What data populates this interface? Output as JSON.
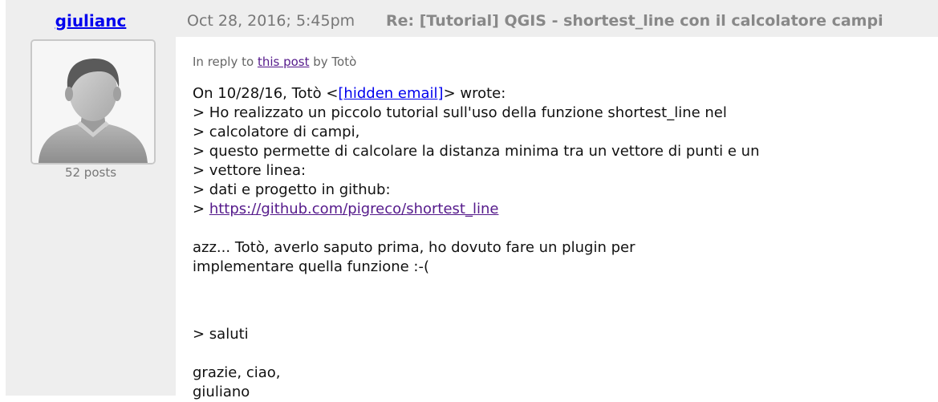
{
  "author": {
    "name": "giulianc",
    "posts": "52 posts"
  },
  "header": {
    "date": "Oct 28, 2016; 5:45pm",
    "subject": "Re: [Tutorial] QGIS - shortest_line con il calcolatore campi"
  },
  "reply": {
    "prefix": "In reply to ",
    "link": "this post",
    "suffix": " by Totò"
  },
  "message": {
    "intro_prefix": "On 10/28/16, Totò <",
    "intro_link": "[hidden email]",
    "intro_suffix": "> wrote:",
    "quote_lines": [
      "> Ho realizzato un piccolo tutorial sull'uso della funzione shortest_line nel",
      "> calcolatore di campi,",
      "> questo permette di calcolare la distanza minima tra un vettore di punti e un",
      "> vettore linea:",
      "> dati e progetto in github:"
    ],
    "url_prefix": "> ",
    "url": "https://github.com/pigreco/shortest_line",
    "reply_lines": [
      "azz... Totò, averlo saputo prima, ho dovuto fare un plugin per",
      "implementare quella funzione :-("
    ],
    "saluti": "> saluti",
    "closing_lines": [
      "grazie, ciao,",
      "giuliano"
    ]
  },
  "colors": {
    "link": "#0000ee",
    "visited_link": "#551a8b",
    "post_background": "#eeeeee",
    "muted_text": "#777777"
  },
  "icons": {
    "avatar": "default-user-silhouette-icon"
  }
}
